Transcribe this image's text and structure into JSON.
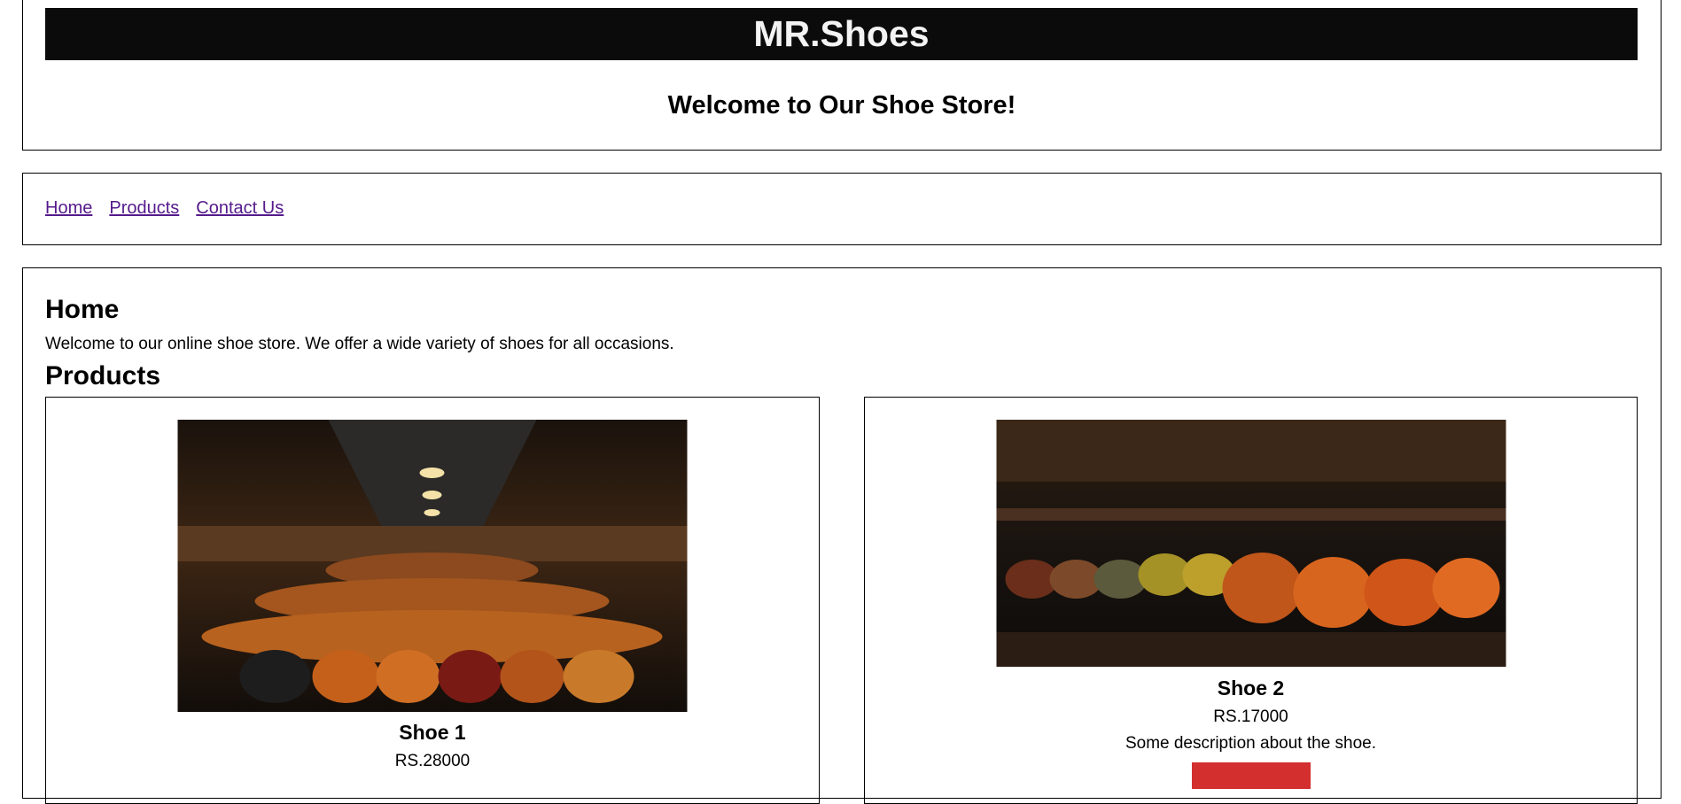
{
  "header": {
    "brand": "MR.Shoes",
    "welcome": "Welcome to Our Shoe Store!"
  },
  "nav": {
    "links": [
      "Home",
      "Products",
      "Contact Us"
    ]
  },
  "home": {
    "heading": "Home",
    "text": "Welcome to our online shoe store. We offer a wide variety of shoes for all occasions."
  },
  "products": {
    "heading": "Products",
    "items": [
      {
        "name": "Shoe 1",
        "price": "RS.28000"
      },
      {
        "name": "Shoe 2",
        "price": "RS.17000",
        "description": "Some description about the shoe."
      }
    ]
  },
  "colors": {
    "brand_bar": "#0b0b0b",
    "link": "#551a8b",
    "button": "#d32f2f"
  }
}
